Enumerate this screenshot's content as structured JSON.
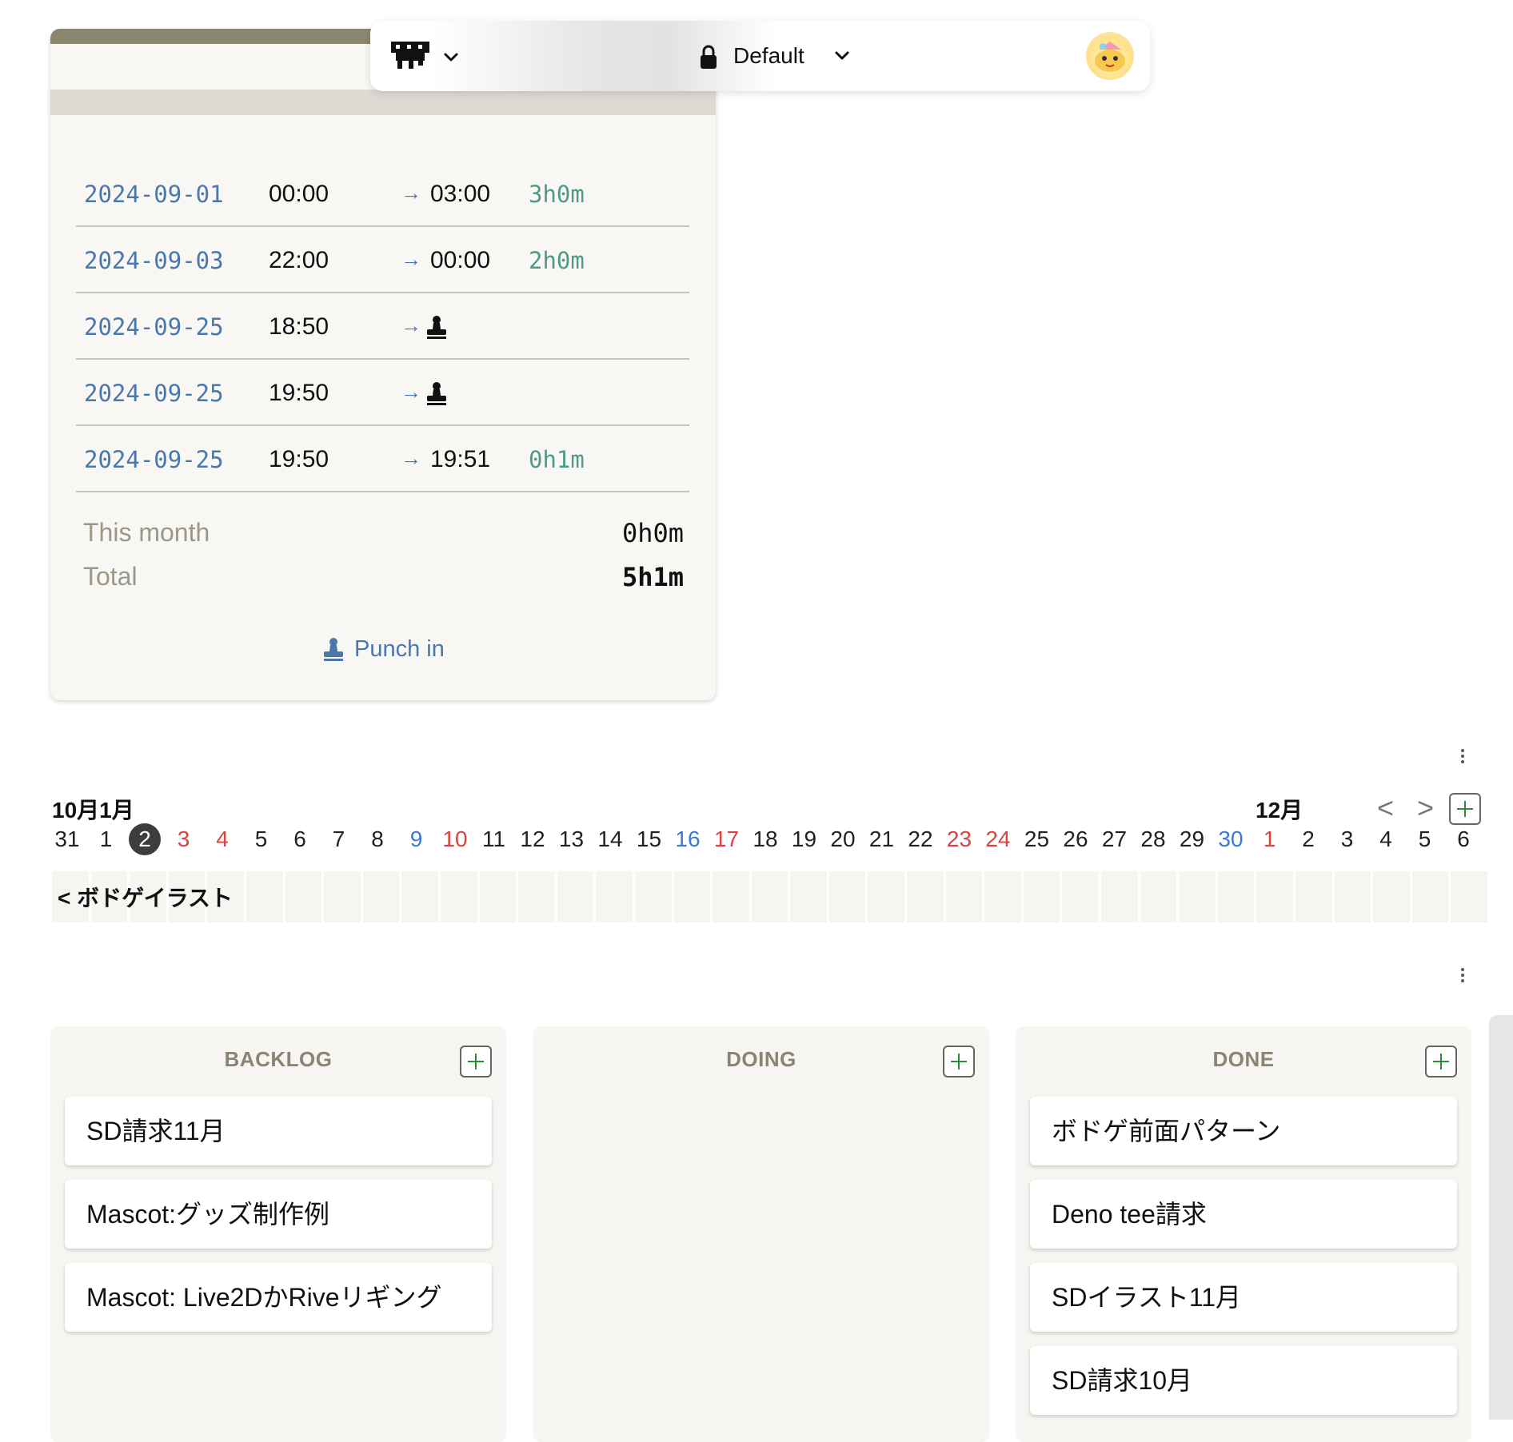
{
  "toolbar": {
    "workspace_label": "Default"
  },
  "timecard": {
    "logs": [
      {
        "date": "2024-09-01",
        "start": "00:00",
        "arrow": "→",
        "end": "03:00",
        "duration": "3h0m",
        "stamp": false
      },
      {
        "date": "2024-09-03",
        "start": "22:00",
        "arrow": "→",
        "end": "00:00",
        "duration": "2h0m",
        "stamp": false
      },
      {
        "date": "2024-09-25",
        "start": "18:50",
        "arrow": "→",
        "end": "",
        "duration": "",
        "stamp": true
      },
      {
        "date": "2024-09-25",
        "start": "19:50",
        "arrow": "→",
        "end": "",
        "duration": "",
        "stamp": true
      },
      {
        "date": "2024-09-25",
        "start": "19:50",
        "arrow": "→",
        "end": "19:51",
        "duration": "0h1m",
        "stamp": false
      }
    ],
    "this_month_label": "This month",
    "this_month_value": "0h0m",
    "total_label": "Total",
    "total_value": "5h1m",
    "punch_label": "Punch in"
  },
  "calendar": {
    "month_left": "10月1月",
    "month_right": "12月",
    "prev": "<",
    "next": ">",
    "days": [
      {
        "n": "31",
        "c": ""
      },
      {
        "n": "1",
        "c": ""
      },
      {
        "n": "2",
        "c": "today"
      },
      {
        "n": "3",
        "c": "red"
      },
      {
        "n": "4",
        "c": "red"
      },
      {
        "n": "5",
        "c": ""
      },
      {
        "n": "6",
        "c": ""
      },
      {
        "n": "7",
        "c": ""
      },
      {
        "n": "8",
        "c": ""
      },
      {
        "n": "9",
        "c": "blue"
      },
      {
        "n": "10",
        "c": "red"
      },
      {
        "n": "11",
        "c": ""
      },
      {
        "n": "12",
        "c": ""
      },
      {
        "n": "13",
        "c": ""
      },
      {
        "n": "14",
        "c": ""
      },
      {
        "n": "15",
        "c": ""
      },
      {
        "n": "16",
        "c": "blue"
      },
      {
        "n": "17",
        "c": "red"
      },
      {
        "n": "18",
        "c": ""
      },
      {
        "n": "19",
        "c": ""
      },
      {
        "n": "20",
        "c": ""
      },
      {
        "n": "21",
        "c": ""
      },
      {
        "n": "22",
        "c": ""
      },
      {
        "n": "23",
        "c": "red"
      },
      {
        "n": "24",
        "c": "red"
      },
      {
        "n": "25",
        "c": ""
      },
      {
        "n": "26",
        "c": ""
      },
      {
        "n": "27",
        "c": ""
      },
      {
        "n": "28",
        "c": ""
      },
      {
        "n": "29",
        "c": ""
      },
      {
        "n": "30",
        "c": "blue"
      },
      {
        "n": "1",
        "c": "red"
      },
      {
        "n": "2",
        "c": ""
      },
      {
        "n": "3",
        "c": ""
      },
      {
        "n": "4",
        "c": ""
      },
      {
        "n": "5",
        "c": ""
      },
      {
        "n": "6",
        "c": ""
      }
    ],
    "project_label": "< ボドゲイラスト"
  },
  "kanban": {
    "columns": [
      {
        "title": "BACKLOG",
        "cards": [
          "SD請求11月",
          "Mascot:グッズ制作例",
          "Mascot: Live2DかRiveリギング"
        ]
      },
      {
        "title": "DOING",
        "cards": []
      },
      {
        "title": "DONE",
        "cards": [
          "ボドゲ前面パターン",
          "Deno tee請求",
          "SDイラスト11月",
          "SD請求10月"
        ]
      }
    ]
  },
  "colors": {
    "link_blue": "#4a78ab",
    "duration_teal": "#4d9a8a",
    "holiday_red": "#d9433f",
    "saturday_blue": "#3c78d8",
    "accent_green": "#2e8b3a"
  }
}
